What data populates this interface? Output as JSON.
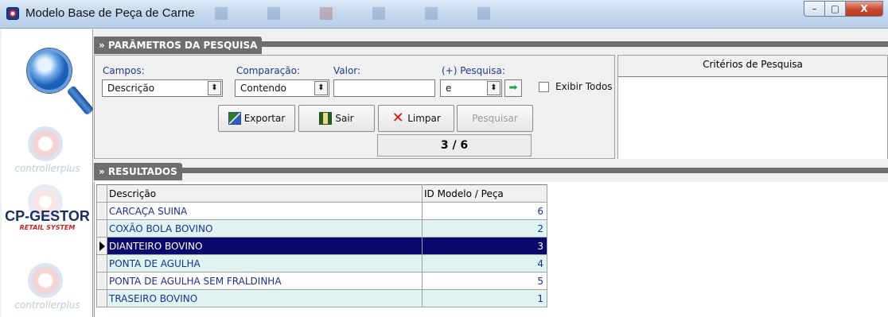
{
  "window": {
    "title": "Modelo Base de Peça de Carne",
    "min_glyph": "–",
    "max_glyph": "▢",
    "close_glyph": "X"
  },
  "sidebar": {
    "brand_top": "controllerplus",
    "gestor_title": "CP-GESTOR",
    "gestor_sub": "RETAIL SYSTEM",
    "brand_bottom": "controllerplus"
  },
  "params": {
    "section_title": "» PARÂMETROS DA PESQUISA",
    "campos_label": "Campos:",
    "campos_value": "Descrição",
    "comparacao_label": "Comparação:",
    "comparacao_value": "Contendo",
    "valor_label": "Valor:",
    "valor_value": "",
    "mais_label": "(+) Pesquisa:",
    "mais_value": "e",
    "exibir_label": "Exibir Todos",
    "combo_arrow": "⬍",
    "go_arrow": "➡"
  },
  "buttons": {
    "exportar": "Exportar",
    "sair": "Sair",
    "limpar": "Limpar",
    "pesquisar": "Pesquisar",
    "clear_glyph": "✕"
  },
  "counter": "3 / 6",
  "criteria": {
    "title": "Critérios de Pesquisa"
  },
  "results": {
    "section_title": "» RESULTADOS",
    "columns": [
      "Descrição",
      "ID Modelo / Peça"
    ],
    "rows": [
      {
        "descricao": "CARCAÇA SUINA",
        "id": "6"
      },
      {
        "descricao": "COXÃO BOLA BOVINO",
        "id": "2"
      },
      {
        "descricao": "DIANTEIRO BOVINO",
        "id": "3"
      },
      {
        "descricao": "PONTA DE AGULHA",
        "id": "4"
      },
      {
        "descricao": "PONTA DE AGULHA SEM FRALDINHA",
        "id": "5"
      },
      {
        "descricao": "TRASEIRO BOVINO",
        "id": "1"
      }
    ],
    "selected_index": 2
  }
}
